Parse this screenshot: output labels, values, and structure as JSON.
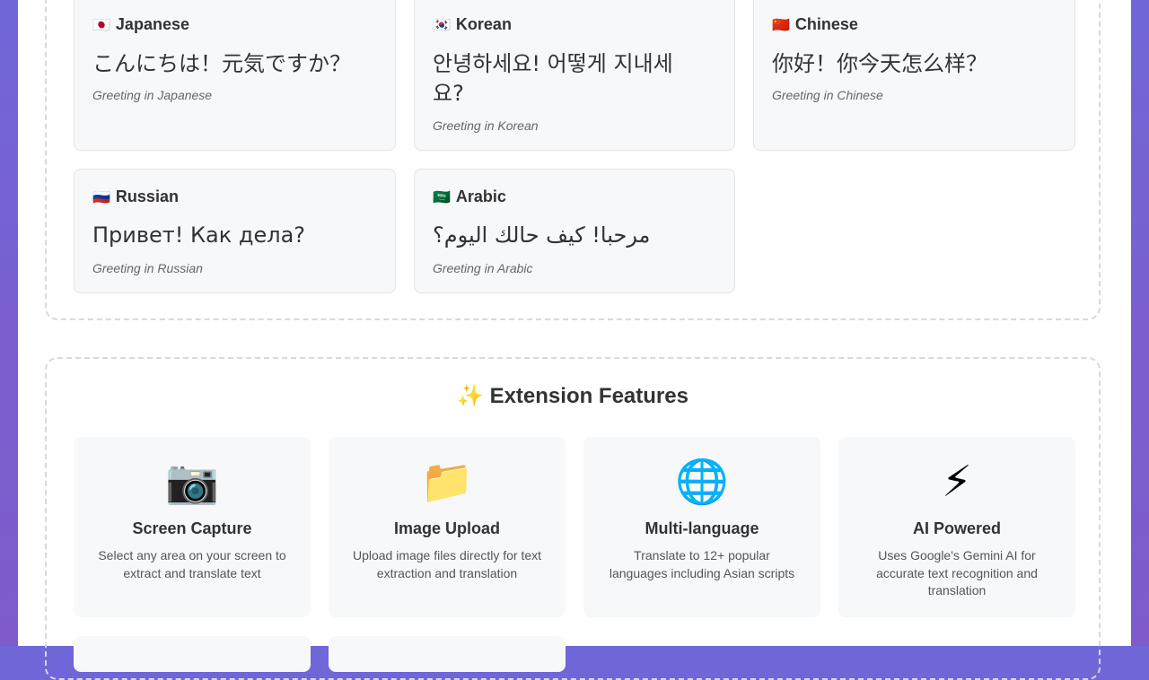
{
  "samples": [
    {
      "flag": "🇯🇵",
      "language": "Japanese",
      "text": "こんにちは！元気ですか？",
      "caption": "Greeting in Japanese"
    },
    {
      "flag": "🇰🇷",
      "language": "Korean",
      "text": "안녕하세요! 어떻게 지내세요?",
      "caption": "Greeting in Korean"
    },
    {
      "flag": "🇨🇳",
      "language": "Chinese",
      "text": "你好！你今天怎么样？",
      "caption": "Greeting in Chinese"
    },
    {
      "flag": "🇷🇺",
      "language": "Russian",
      "text": "Привет! Как дела?",
      "caption": "Greeting in Russian"
    },
    {
      "flag": "🇸🇦",
      "language": "Arabic",
      "text": "مرحبا! كيف حالك اليوم؟",
      "caption": "Greeting in Arabic"
    }
  ],
  "features": {
    "title": "✨ Extension Features",
    "items": [
      {
        "icon": "📷",
        "icon_name": "camera-icon",
        "title": "Screen Capture",
        "desc": "Select any area on your screen to extract and translate text"
      },
      {
        "icon": "📁",
        "icon_name": "folder-icon",
        "title": "Image Upload",
        "desc": "Upload image files directly for text extraction and translation"
      },
      {
        "icon": "🌐",
        "icon_name": "globe-icon",
        "title": "Multi-language",
        "desc": "Translate to 12+ popular languages including Asian scripts"
      },
      {
        "icon": "⚡",
        "icon_name": "lightning-icon",
        "title": "AI Powered",
        "desc": "Uses Google's Gemini AI for accurate text recognition and translation"
      }
    ]
  }
}
